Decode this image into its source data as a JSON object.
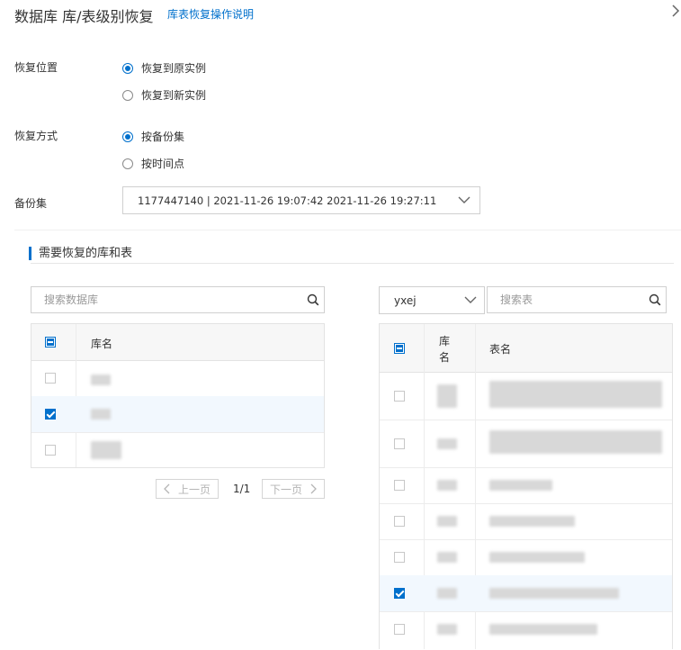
{
  "header": {
    "title": "数据库 库/表级别恢复",
    "help_link": "库表恢复操作说明"
  },
  "restore_location": {
    "label": "恢复位置",
    "options": [
      "恢复到原实例",
      "恢复到新实例"
    ],
    "selected_index": 0
  },
  "restore_method": {
    "label": "恢复方式",
    "options": [
      "按备份集",
      "按时间点"
    ],
    "selected_index": 0
  },
  "backup_set": {
    "label": "备份集",
    "value": "1177447140 | 2021-11-26 19:07:42 2021-11-26 19:27:11"
  },
  "section": {
    "title": "需要恢复的库和表"
  },
  "db_panel": {
    "search_placeholder": "搜索数据库",
    "header_col": "库名",
    "rows_checked": [
      false,
      true,
      false
    ],
    "pager": {
      "prev": "上一页",
      "next": "下一页",
      "info": "1/1"
    }
  },
  "table_panel": {
    "db_select_value": "yxej",
    "search_placeholder": "搜索表",
    "header_col_db_line1": "库",
    "header_col_db_line2": "名",
    "header_col_table": "表名",
    "rows_checked": [
      false,
      false,
      false,
      false,
      false,
      true,
      false
    ]
  }
}
